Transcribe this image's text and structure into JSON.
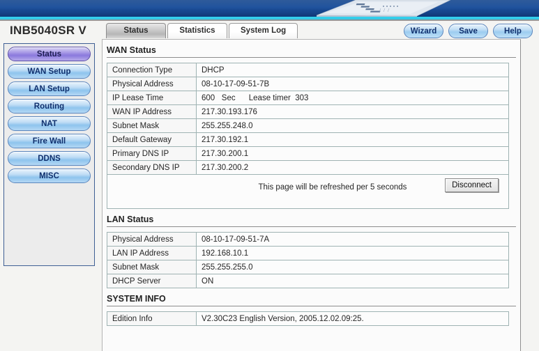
{
  "banner": {
    "device_icon": "router-device-image"
  },
  "header": {
    "brand_title": "INB5040SR V",
    "tabs": [
      {
        "label": "Status",
        "active": true
      },
      {
        "label": "Statistics",
        "active": false
      },
      {
        "label": "System Log",
        "active": false
      }
    ],
    "actions": [
      {
        "label": "Wizard"
      },
      {
        "label": "Save"
      },
      {
        "label": "Help"
      }
    ]
  },
  "sidebar": {
    "items": [
      {
        "label": "Status",
        "active": true
      },
      {
        "label": "WAN Setup",
        "active": false
      },
      {
        "label": "LAN Setup",
        "active": false
      },
      {
        "label": "Routing",
        "active": false
      },
      {
        "label": "NAT",
        "active": false
      },
      {
        "label": "Fire Wall",
        "active": false
      },
      {
        "label": "DDNS",
        "active": false
      },
      {
        "label": "MISC",
        "active": false
      }
    ]
  },
  "wan_status": {
    "heading": "WAN Status",
    "rows": [
      {
        "key": "Connection Type",
        "value": "DHCP"
      },
      {
        "key": "Physical Address",
        "value": "08-10-17-09-51-7B"
      },
      {
        "key": "IP Lease Time",
        "value": "600   Sec      Lease timer  303"
      },
      {
        "key": "WAN IP Address",
        "value": "217.30.193.176"
      },
      {
        "key": "Subnet Mask",
        "value": "255.255.248.0"
      },
      {
        "key": "Default Gateway",
        "value": "217.30.192.1"
      },
      {
        "key": "Primary DNS IP",
        "value": "217.30.200.1"
      },
      {
        "key": "Secondary DNS IP",
        "value": "217.30.200.2"
      }
    ],
    "refresh_note": "This page will be refreshed per 5 seconds",
    "disconnect_label": "Disconnect"
  },
  "lan_status": {
    "heading": "LAN Status",
    "rows": [
      {
        "key": "Physical Address",
        "value": "08-10-17-09-51-7A"
      },
      {
        "key": "LAN IP Address",
        "value": "192.168.10.1"
      },
      {
        "key": "Subnet Mask",
        "value": "255.255.255.0"
      },
      {
        "key": "DHCP Server",
        "value": "ON"
      }
    ]
  },
  "system_info": {
    "heading": "SYSTEM INFO",
    "rows": [
      {
        "key": "Edition Info",
        "value": "V2.30C23 English Version, 2005.12.02.09:25."
      }
    ]
  },
  "colors": {
    "banner_blue": "#17488f",
    "banner_stripe": "#27c9e8",
    "active_nav": "#8a79dd",
    "nav_blue": "#8ec4ed",
    "text_navy": "#10306e"
  }
}
